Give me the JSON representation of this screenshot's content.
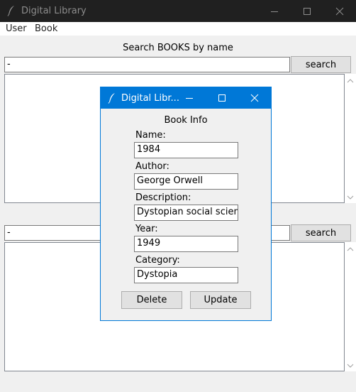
{
  "window": {
    "title": "Digital Library"
  },
  "menu": [
    "User",
    "Book"
  ],
  "search_section": {
    "title": "Search BOOKS by name",
    "input_value": "-",
    "button_label": "search"
  },
  "second_search": {
    "input_value": "-",
    "button_label": "search"
  },
  "dialog": {
    "title": "Digital Libr...",
    "header": "Book Info",
    "fields": [
      {
        "label": "Name:",
        "value": "1984"
      },
      {
        "label": "Author:",
        "value": "George Orwell"
      },
      {
        "label": "Description:",
        "value": "Dystopian social science"
      },
      {
        "label": "Year:",
        "value": "1949"
      },
      {
        "label": "Category:",
        "value": "Dystopia"
      }
    ],
    "delete_label": "Delete",
    "update_label": "Update"
  },
  "colors": {
    "titlebar_bg": "#202020",
    "dialog_titlebar_bg": "#0078d7",
    "window_bg": "#f0f0f0"
  },
  "icons": [
    "feather-icon",
    "minimize-icon",
    "maximize-icon",
    "close-icon",
    "scroll-up-icon",
    "scroll-down-icon"
  ]
}
